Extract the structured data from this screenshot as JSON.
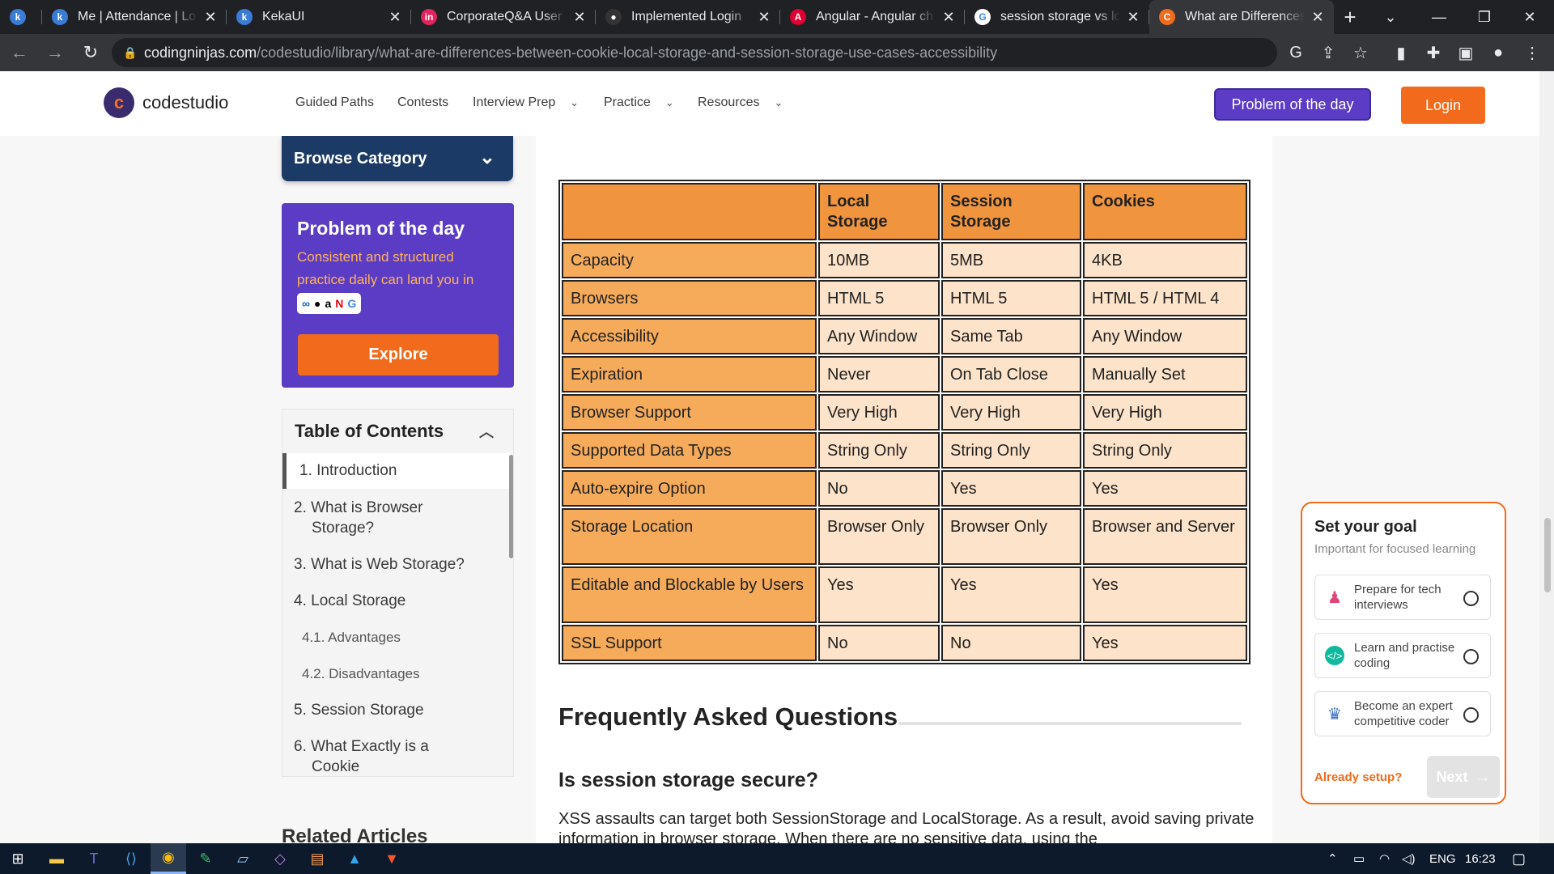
{
  "browser": {
    "tabs": [
      {
        "title": "",
        "fav": "k",
        "favColor": "#3a7bd5"
      },
      {
        "title": "Me | Attendance | Lo",
        "fav": "k",
        "favColor": "#3a7bd5"
      },
      {
        "title": "KekaUI",
        "fav": "k",
        "favColor": "#3a7bd5"
      },
      {
        "title": "CorporateQ&A User",
        "fav": "in",
        "favColor": "#e0245e"
      },
      {
        "title": "Implemented Login",
        "fav": "●",
        "favColor": "#333333"
      },
      {
        "title": "Angular - Angular ch",
        "fav": "A",
        "favColor": "#dd0031"
      },
      {
        "title": "session storage vs lo",
        "fav": "G",
        "favColor": "#ffffff"
      },
      {
        "title": "What are Differences",
        "fav": "C",
        "favColor": "#f26a1b"
      }
    ],
    "new_tab": "+",
    "url_host": "codingninjas.com",
    "url_path": "/codestudio/library/what-are-differences-between-cookie-local-storage-and-session-storage-use-cases-accessibility"
  },
  "site": {
    "logo_text": "codestudio",
    "nav": [
      "Guided Paths",
      "Contests",
      "Interview Prep",
      "Practice",
      "Resources"
    ],
    "potd_button": "Problem of the day",
    "login_button": "Login"
  },
  "sidebar": {
    "browse_category": "Browse Category",
    "potd": {
      "title": "Problem of the day",
      "subtitle": "Consistent and structured practice daily can land you in",
      "explore": "Explore"
    },
    "toc": {
      "title": "Table of Contents",
      "items": [
        "1. Introduction",
        "2. What is Browser Storage?",
        "3. What is Web Storage?",
        "4. Local Storage",
        "4.1. Advantages",
        "4.2. Disadvantages",
        "5. Session Storage",
        "6. What Exactly is a Cookie"
      ]
    },
    "related": "Related Articles"
  },
  "table": {
    "headers": [
      "",
      "Local Storage",
      "Session Storage",
      "Cookies"
    ],
    "rows": [
      [
        "Capacity",
        "10MB",
        "5MB",
        "4KB"
      ],
      [
        "Browsers",
        "HTML 5",
        "HTML 5",
        "HTML 5 / HTML 4"
      ],
      [
        "Accessibility",
        "Any Window",
        "Same Tab",
        "Any Window"
      ],
      [
        "Expiration",
        "Never",
        "On Tab Close",
        "Manually Set"
      ],
      [
        "Browser Support",
        "Very High",
        "Very High",
        "Very High"
      ],
      [
        "Supported Data Types",
        "String Only",
        "String Only",
        "String Only"
      ],
      [
        "Auto-expire Option",
        "No",
        "Yes",
        "Yes"
      ],
      [
        "Storage Location",
        "Browser Only",
        "Browser Only",
        "Browser and Server"
      ],
      [
        "Editable and Blockable by Users",
        "Yes",
        "Yes",
        "Yes"
      ],
      [
        "SSL Support",
        "No",
        "No",
        "Yes"
      ]
    ]
  },
  "article": {
    "faq_title": "Frequently Asked Questions",
    "q1": "Is session storage secure?",
    "a1": "XSS assaults can target both SessionStorage and LocalStorage. As a result, avoid saving private information in browser storage. When there are no sensitive data, using the"
  },
  "goal": {
    "title": "Set your goal",
    "subtitle": "Important for focused learning",
    "options": [
      "Prepare for tech interviews",
      "Learn and practise coding",
      "Become an expert competitive coder"
    ],
    "already": "Already setup?",
    "next": "Next"
  },
  "taskbar": {
    "lang": "ENG",
    "time": "16:23"
  }
}
